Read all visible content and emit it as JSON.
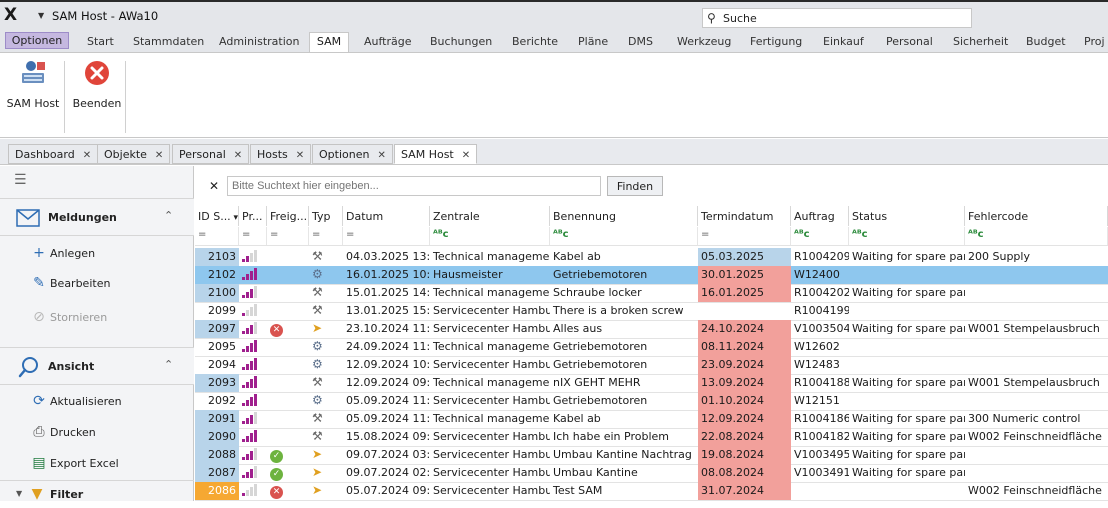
{
  "window": {
    "title": "SAM Host - AWa10",
    "search_label": "Suche",
    "app_icon": "x-logo-icon"
  },
  "menu": {
    "items": [
      {
        "label": "Optionen"
      },
      {
        "label": "Start"
      },
      {
        "label": "Stammdaten"
      },
      {
        "label": "Administration"
      },
      {
        "label": "SAM"
      },
      {
        "label": "Aufträge"
      },
      {
        "label": "Buchungen"
      },
      {
        "label": "Berichte"
      },
      {
        "label": "Pläne"
      },
      {
        "label": "DMS"
      },
      {
        "label": "Werkzeug"
      },
      {
        "label": "Fertigung"
      },
      {
        "label": "Einkauf"
      },
      {
        "label": "Personal"
      },
      {
        "label": "Sicherheit"
      },
      {
        "label": "Budget"
      },
      {
        "label": "Proj"
      }
    ],
    "active": "SAM",
    "highlight_color": "#c5b8e0"
  },
  "ribbon": {
    "buttons": [
      {
        "label": "SAM Host",
        "icon": "sam-host-icon"
      },
      {
        "label": "Beenden",
        "icon": "close-circle-icon"
      }
    ]
  },
  "doc_tabs": [
    {
      "label": "Dashboard"
    },
    {
      "label": "Objekte"
    },
    {
      "label": "Personal"
    },
    {
      "label": "Hosts"
    },
    {
      "label": "Optionen"
    },
    {
      "label": "SAM Host"
    }
  ],
  "sidebar": {
    "sections": [
      {
        "title": "Meldungen",
        "icon": "mail-icon",
        "items": [
          {
            "label": "Anlegen",
            "icon": "plus-icon"
          },
          {
            "label": "Bearbeiten",
            "icon": "pencil-icon"
          },
          {
            "label": "Stornieren",
            "icon": "cancel-icon",
            "disabled": true
          }
        ]
      },
      {
        "title": "Ansicht",
        "icon": "magnifier-icon",
        "items": [
          {
            "label": "Aktualisieren",
            "icon": "refresh-icon"
          },
          {
            "label": "Drucken",
            "icon": "printer-icon"
          },
          {
            "label": "Export Excel",
            "icon": "excel-icon"
          }
        ]
      }
    ],
    "filter_label": "Filter"
  },
  "search": {
    "placeholder": "Bitte Suchtext hier eingeben...",
    "button_label": "Finden"
  },
  "table": {
    "columns": [
      "ID S...",
      "Pr...",
      "Freig...",
      "Typ",
      "Datum",
      "Zentrale",
      "Benennung",
      "Termindatum",
      "Auftrag",
      "Status",
      "Fehlercode"
    ],
    "filter_row": [
      "=",
      "=",
      "=",
      "=",
      "=",
      "ᴬᴮc",
      "ᴬᴮc",
      "=",
      "ᴬᴮc",
      "ᴬᴮc",
      "ᴬᴮc"
    ],
    "rows": [
      {
        "id": "2103",
        "prio": 2,
        "freig": "",
        "typ": "tools",
        "datum": "04.03.2025 13:...",
        "zentrale": "Technical management",
        "benennung": "Kabel ab",
        "termin": "05.03.2025",
        "termin_style": "blue",
        "auftrag": "R1004209",
        "status": "Waiting for spare part",
        "fehler": "200 Supply",
        "id_style": "blue"
      },
      {
        "id": "2102",
        "prio": 4,
        "freig": "",
        "typ": "gear",
        "datum": "16.01.2025 10:...",
        "zentrale": "Hausmeister",
        "benennung": "Getriebemotoren",
        "termin": "30.01.2025",
        "termin_style": "red",
        "auftrag": "W12400",
        "status": "",
        "fehler": "",
        "selected": true,
        "id_style": "blue"
      },
      {
        "id": "2100",
        "prio": 3,
        "freig": "",
        "typ": "tools",
        "datum": "15.01.2025 14:...",
        "zentrale": "Technical management",
        "benennung": "Schraube locker",
        "termin": "16.01.2025",
        "termin_style": "red",
        "auftrag": "R1004202",
        "status": "Waiting for spare part",
        "fehler": "",
        "id_style": "blue"
      },
      {
        "id": "2099",
        "prio": 1,
        "freig": "",
        "typ": "tools",
        "datum": "13.01.2025 15:...",
        "zentrale": "Servicecenter Hamburg",
        "benennung": "There is a broken screw",
        "termin": "",
        "termin_style": "",
        "auftrag": "R1004199",
        "status": "",
        "fehler": "",
        "id_style": ""
      },
      {
        "id": "2097",
        "prio": 3,
        "freig": "reject",
        "typ": "arrow",
        "datum": "23.10.2024 11:...",
        "zentrale": "Servicecenter Hamburg",
        "benennung": "Alles aus",
        "termin": "24.10.2024",
        "termin_style": "red",
        "auftrag": "V1003504",
        "status": "Waiting for spare part",
        "fehler": "W001 Stempelausbruch",
        "id_style": "blue"
      },
      {
        "id": "2095",
        "prio": 4,
        "freig": "",
        "typ": "gear",
        "datum": "24.09.2024 11:...",
        "zentrale": "Technical management",
        "benennung": "Getriebemotoren",
        "termin": "08.11.2024",
        "termin_style": "red",
        "auftrag": "W12602",
        "status": "",
        "fehler": "",
        "id_style": ""
      },
      {
        "id": "2094",
        "prio": 4,
        "freig": "",
        "typ": "gear",
        "datum": "12.09.2024 10:...",
        "zentrale": "Servicecenter Hamburg",
        "benennung": "Getriebemotoren",
        "termin": "23.09.2024",
        "termin_style": "red",
        "auftrag": "W12483",
        "status": "",
        "fehler": "",
        "id_style": ""
      },
      {
        "id": "2093",
        "prio": 4,
        "freig": "",
        "typ": "tools",
        "datum": "12.09.2024 09:...",
        "zentrale": "Technical management",
        "benennung": "nIX GEHT MEHR",
        "termin": "13.09.2024",
        "termin_style": "red",
        "auftrag": "R1004188",
        "status": "Waiting for spare part",
        "fehler": "W001 Stempelausbruch",
        "id_style": "blue"
      },
      {
        "id": "2092",
        "prio": 4,
        "freig": "",
        "typ": "gear",
        "datum": "05.09.2024 11:...",
        "zentrale": "Servicecenter Hamburg",
        "benennung": "Getriebemotoren",
        "termin": "01.10.2024",
        "termin_style": "red",
        "auftrag": "W12151",
        "status": "",
        "fehler": "",
        "id_style": ""
      },
      {
        "id": "2091",
        "prio": 3,
        "freig": "",
        "typ": "tools",
        "datum": "05.09.2024 11:...",
        "zentrale": "Technical management",
        "benennung": "Kabel ab",
        "termin": "12.09.2024",
        "termin_style": "red",
        "auftrag": "R1004186",
        "status": "Waiting for spare part",
        "fehler": "300 Numeric control",
        "id_style": "blue"
      },
      {
        "id": "2090",
        "prio": 4,
        "freig": "",
        "typ": "tools",
        "datum": "15.08.2024 09:...",
        "zentrale": "Servicecenter Hamburg",
        "benennung": "Ich habe ein Problem",
        "termin": "22.08.2024",
        "termin_style": "red",
        "auftrag": "R1004182",
        "status": "Waiting for spare part",
        "fehler": "W002 Feinschneidfläche",
        "id_style": "blue"
      },
      {
        "id": "2088",
        "prio": 3,
        "freig": "ok",
        "typ": "arrow",
        "datum": "09.07.2024 03:...",
        "zentrale": "Servicecenter Hamburg",
        "benennung": "Umbau Kantine Nachtrag",
        "termin": "19.08.2024",
        "termin_style": "red",
        "auftrag": "V1003495",
        "status": "Waiting for spare part",
        "fehler": "",
        "id_style": "blue"
      },
      {
        "id": "2087",
        "prio": 3,
        "freig": "ok",
        "typ": "arrow",
        "datum": "09.07.2024 02:...",
        "zentrale": "Servicecenter Hamburg",
        "benennung": "Umbau Kantine",
        "termin": "08.08.2024",
        "termin_style": "red",
        "auftrag": "V1003491",
        "status": "Waiting for spare part",
        "fehler": "",
        "id_style": "blue"
      },
      {
        "id": "2086",
        "prio": 1,
        "freig": "reject",
        "typ": "arrow",
        "datum": "05.07.2024 09:...",
        "zentrale": "Servicecenter Hamburg",
        "benennung": "Test SAM",
        "termin": "31.07.2024",
        "termin_style": "red",
        "auftrag": "",
        "status": "",
        "fehler": "W002 Feinschneidfläche",
        "id_style": "orange"
      }
    ]
  },
  "colors": {
    "accent_blue": "#b8d4ea",
    "selected_row": "#8ec7ee",
    "overdue_red": "#f2a09b",
    "prio_orange": "#f6a832",
    "prio_bar": "#a0208e"
  }
}
